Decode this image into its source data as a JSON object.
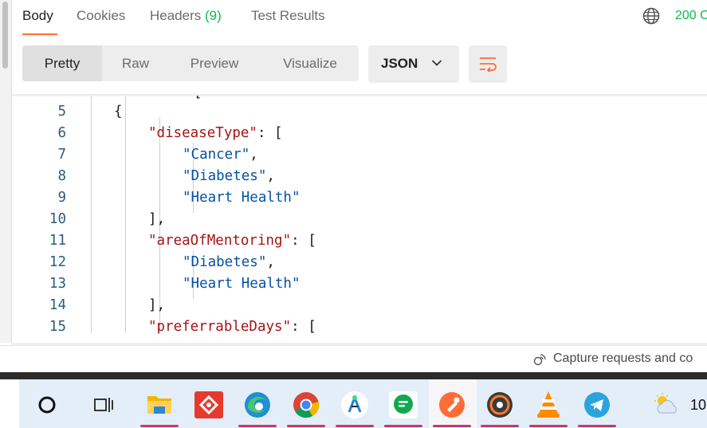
{
  "response_tabs": [
    {
      "label": "Body",
      "active": true
    },
    {
      "label": "Cookies"
    },
    {
      "label": "Headers",
      "count": "(9)"
    },
    {
      "label": "Test Results"
    }
  ],
  "status_text": "200 O",
  "view_modes": [
    "Pretty",
    "Raw",
    "Preview",
    "Visualize"
  ],
  "active_view": "Pretty",
  "format": "JSON",
  "code_lines": [
    {
      "num": "5",
      "indent": 2,
      "parts": [
        {
          "t": "{",
          "c": "p"
        }
      ]
    },
    {
      "num": "6",
      "indent": 3,
      "parts": [
        {
          "t": "\"diseaseType\"",
          "c": "key"
        },
        {
          "t": ": [",
          "c": "p"
        }
      ]
    },
    {
      "num": "7",
      "indent": 4,
      "parts": [
        {
          "t": "\"Cancer\"",
          "c": "str"
        },
        {
          "t": ",",
          "c": "p"
        }
      ]
    },
    {
      "num": "8",
      "indent": 4,
      "parts": [
        {
          "t": "\"Diabetes\"",
          "c": "str"
        },
        {
          "t": ",",
          "c": "p"
        }
      ]
    },
    {
      "num": "9",
      "indent": 4,
      "parts": [
        {
          "t": "\"Heart Health\"",
          "c": "str"
        }
      ]
    },
    {
      "num": "10",
      "indent": 3,
      "parts": [
        {
          "t": "],",
          "c": "p"
        }
      ]
    },
    {
      "num": "11",
      "indent": 3,
      "parts": [
        {
          "t": "\"areaOfMentoring\"",
          "c": "key"
        },
        {
          "t": ": [",
          "c": "p"
        }
      ]
    },
    {
      "num": "12",
      "indent": 4,
      "parts": [
        {
          "t": "\"Diabetes\"",
          "c": "str"
        },
        {
          "t": ",",
          "c": "p"
        }
      ]
    },
    {
      "num": "13",
      "indent": 4,
      "parts": [
        {
          "t": "\"Heart Health\"",
          "c": "str"
        }
      ]
    },
    {
      "num": "14",
      "indent": 3,
      "parts": [
        {
          "t": "],",
          "c": "p"
        }
      ]
    },
    {
      "num": "15",
      "indent": 3,
      "parts": [
        {
          "t": "\"preferrableDays\"",
          "c": "key"
        },
        {
          "t": ": [",
          "c": "p"
        }
      ]
    }
  ],
  "capture_text": "Capture requests and co",
  "taskbar_icons": [
    {
      "name": "search-icon",
      "active": false
    },
    {
      "name": "task-view-icon",
      "active": false
    },
    {
      "name": "file-explorer-icon",
      "active": true
    },
    {
      "name": "git-app-icon",
      "active": false
    },
    {
      "name": "edge-browser-icon",
      "active": true
    },
    {
      "name": "chrome-browser-icon",
      "active": true
    },
    {
      "name": "android-studio-icon",
      "active": true
    },
    {
      "name": "chat-app-icon",
      "active": true
    },
    {
      "name": "postman-icon",
      "active": true
    },
    {
      "name": "media-player-icon",
      "active": true
    },
    {
      "name": "vlc-icon",
      "active": true
    },
    {
      "name": "telegram-icon",
      "active": true
    }
  ],
  "clock": "10",
  "colors": {
    "accent": "#ff6c37",
    "success": "#0cbb52",
    "json_key": "#a31515",
    "json_string": "#0451a5"
  }
}
